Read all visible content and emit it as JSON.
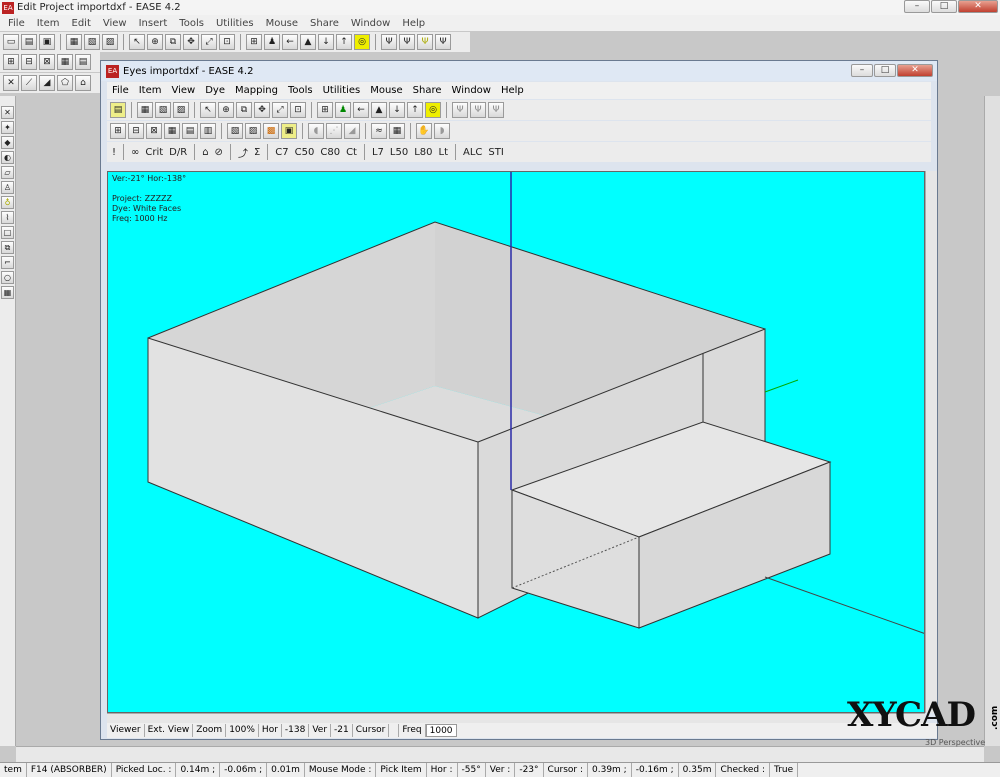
{
  "outer": {
    "title": "Edit Project importdxf - EASE 4.2",
    "menu": [
      "File",
      "Item",
      "Edit",
      "View",
      "Insert",
      "Tools",
      "Utilities",
      "Mouse",
      "Share",
      "Window",
      "Help"
    ],
    "window_controls": {
      "minimize": "–",
      "maximize": "□",
      "close": "✕"
    },
    "side_label": "tem"
  },
  "inner": {
    "title": "Eyes importdxf - EASE 4.2",
    "menu": [
      "File",
      "Item",
      "View",
      "Dye",
      "Mapping",
      "Tools",
      "Utilities",
      "Mouse",
      "Share",
      "Window",
      "Help"
    ],
    "toolbar3_text": [
      "!",
      "Crit",
      "D/R",
      "Σ",
      "C7",
      "C50",
      "C80",
      "Ct",
      "L7",
      "L50",
      "L80",
      "Lt",
      "ALC",
      "STI"
    ]
  },
  "viewport": {
    "angles": "Ver:-21°  Hor:-138°",
    "project_line": "Project: ZZZZZ",
    "dye_line": "Dye: White Faces",
    "freq_line": "Freq: 1000 Hz",
    "perspective_label": "3D Perspective",
    "background_color": "#00ffff"
  },
  "inner_status": {
    "viewer": "Viewer",
    "ext_view": "Ext. View",
    "zoom_label": "Zoom",
    "zoom_value": "100%",
    "hor_label": "Hor",
    "hor_value": "-138",
    "ver_label": "Ver",
    "ver_value": "-21",
    "cursor_label": "Cursor",
    "freq_label": "Freq",
    "freq_value": "1000"
  },
  "status": {
    "item": "F14 (ABSORBER)",
    "picked_loc_label": "Picked Loc. :",
    "picked_x": "0.14m ;",
    "picked_y": "-0.06m ;",
    "picked_z": "0.01m",
    "mouse_mode_label": "Mouse Mode :",
    "mouse_mode": "Pick Item",
    "hor_label": "Hor :",
    "hor_value": "-55°",
    "ver_label": "Ver :",
    "ver_value": "-23°",
    "cursor_label": "Cursor :",
    "cursor_x": "0.39m ;",
    "cursor_y": "-0.16m ;",
    "cursor_z": "0.35m",
    "checked_label": "Checked :",
    "checked_value": "True"
  },
  "watermark": {
    "text": "XYCAD",
    "domain": ".com"
  }
}
